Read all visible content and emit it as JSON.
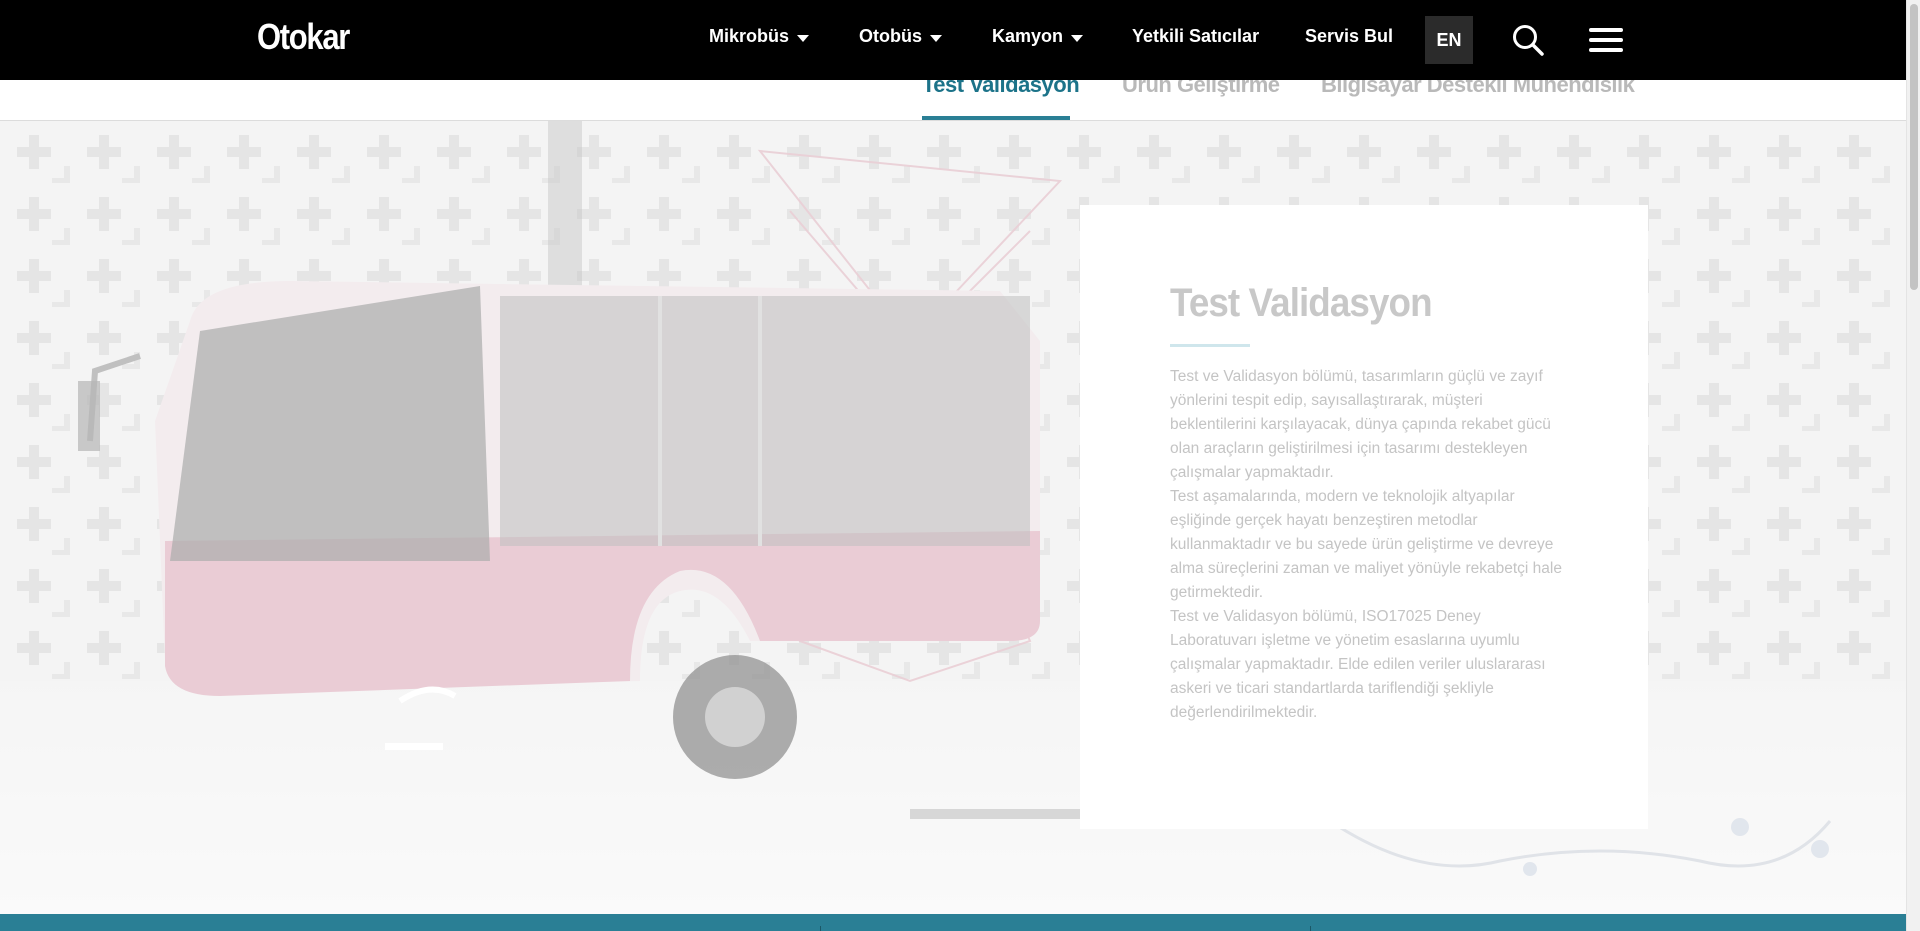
{
  "header": {
    "logo": "Otokar",
    "nav": [
      {
        "label": "Mikrobüs",
        "has_dropdown": true
      },
      {
        "label": "Otobüs",
        "has_dropdown": true
      },
      {
        "label": "Kamyon",
        "has_dropdown": true
      },
      {
        "label": "Yetkili Satıcılar",
        "has_dropdown": false
      },
      {
        "label": "Servis Bul",
        "has_dropdown": false
      }
    ],
    "lang": "EN",
    "icons": {
      "search": "search-icon",
      "menu": "hamburger-menu-icon"
    }
  },
  "subnav": {
    "tabs": [
      {
        "label": "Test Validasyon",
        "active": true
      },
      {
        "label": "Ürün Geliştirme",
        "active": false
      },
      {
        "label": "Bilgisayar Destekli Mühendislik",
        "active": false
      }
    ]
  },
  "content": {
    "title": "Test Validasyon",
    "paragraphs": [
      "Test ve Validasyon bölümü, tasarımların güçlü ve zayıf yönlerini tespit edip, sayısallaştırarak, müşteri beklentilerini karşılayacak, dünya çapında rekabet gücü olan araçların geliştirilmesi için tasarımı destekleyen çalışmalar yapmaktadır.",
      "Test aşamalarında, modern ve teknolojik altyapılar eşliğinde gerçek hayatı benzeştiren metodlar kullanmaktadır ve bu sayede ürün geliştirme ve devreye alma süreçlerini zaman ve maliyet yönüyle rekabetçi hale getirmektedir.",
      "Test ve Validasyon bölümü, ISO17025 Deney Laboratuvarı işletme ve yönetim esaslarına uyumlu çalışmalar yapmaktadır. Elde edilen veriler uluslararası askeri ve ticari standartlarda tariflendiği şekliyle değerlendirilmektedir."
    ]
  },
  "colors": {
    "header_bg": "#000000",
    "accent": "#2a7f95",
    "active_tab": "#1c7389",
    "bus": "#d9a3b3"
  }
}
